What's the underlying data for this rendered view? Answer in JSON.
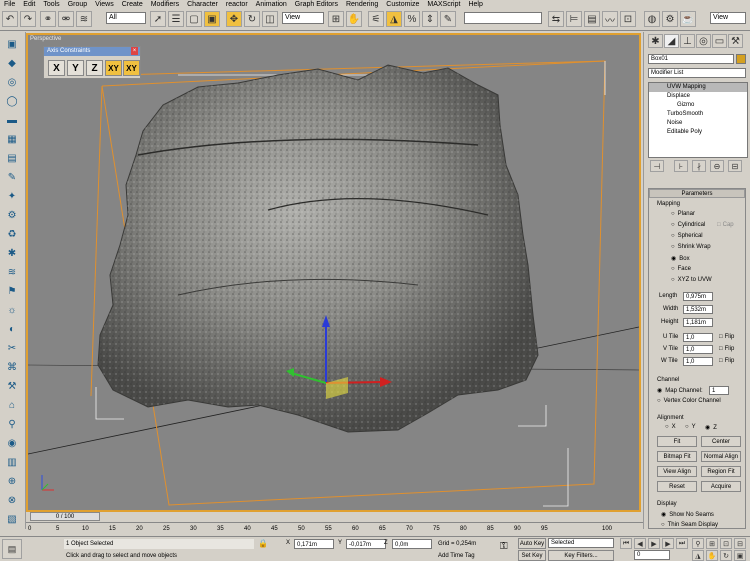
{
  "menu": [
    "File",
    "Edit",
    "Tools",
    "Group",
    "Views",
    "Create",
    "Modifiers",
    "Character",
    "reactor",
    "Animation",
    "Graph Editors",
    "Rendering",
    "Customize",
    "MAXScript",
    "Help"
  ],
  "toolbar": {
    "selection_filter": "All",
    "ref_coord": "View",
    "named_sel": "",
    "view_combo": "View"
  },
  "viewport": {
    "label": "Perspective"
  },
  "axis_constraints": {
    "title": "Axis Constraints",
    "buttons": [
      "X",
      "Y",
      "Z",
      "XY",
      "XY"
    ]
  },
  "modify": {
    "object_name": "Box01",
    "modifier_list": "Modifier List",
    "stack": [
      {
        "label": "UVW Mapping",
        "selected": true
      },
      {
        "label": "Displace",
        "selected": false
      },
      {
        "label": "Gizmo",
        "selected": false
      },
      {
        "label": "TurboSmooth",
        "selected": false
      },
      {
        "label": "Noise",
        "selected": false
      },
      {
        "label": "Editable Poly",
        "selected": false
      }
    ],
    "parameters_title": "Parameters",
    "mapping_title": "Mapping",
    "mapping_options": [
      "Planar",
      "Cylindrical",
      "Spherical",
      "Shrink Wrap",
      "Box",
      "Face",
      "XYZ to UVW"
    ],
    "mapping_selected": "Box",
    "cap_label": "Cap",
    "length_label": "Length",
    "length": "0,975m",
    "width_label": "Width",
    "width": "1,532m",
    "height_label": "Height",
    "height": "1,181m",
    "utile_label": "U Tile",
    "utile": "1,0",
    "vtile_label": "V Tile",
    "vtile": "1,0",
    "wtile_label": "W Tile",
    "wtile": "1,0",
    "flip_label": "Flip",
    "channel_title": "Channel",
    "map_channel_label": "Map Channel:",
    "map_channel": "1",
    "vertex_color_label": "Vertex Color Channel",
    "alignment_title": "Alignment",
    "align_x": "X",
    "align_y": "Y",
    "align_z": "Z",
    "fit": "Fit",
    "center": "Center",
    "bitmap_fit": "Bitmap Fit",
    "normal_align": "Normal Align",
    "view_align": "View Align",
    "region_fit": "Region Fit",
    "reset": "Reset",
    "acquire": "Acquire",
    "display_title": "Display",
    "show_no_seams": "Show No Seams",
    "thin_seam": "Thin Seam Display"
  },
  "timeline": {
    "slider": "0 / 100",
    "ticks": [
      "0",
      "5",
      "10",
      "15",
      "20",
      "25",
      "30",
      "35",
      "40",
      "45",
      "50",
      "55",
      "60",
      "65",
      "70",
      "75",
      "80",
      "85",
      "90",
      "95",
      "100"
    ]
  },
  "status": {
    "selected": "1 Object Selected",
    "prompt": "Click and drag to select and move objects",
    "x_label": "X",
    "x": "0,171m",
    "y_label": "Y",
    "y": "-0,017m",
    "z_label": "Z",
    "z": "0,0m",
    "grid": "Grid = 0,254m",
    "add_time_tag": "Add Time Tag",
    "auto_key": "Auto Key",
    "auto_key_value": "Selected",
    "set_key": "Set Key",
    "key_filters": "Key Filters...",
    "frame": "0"
  }
}
